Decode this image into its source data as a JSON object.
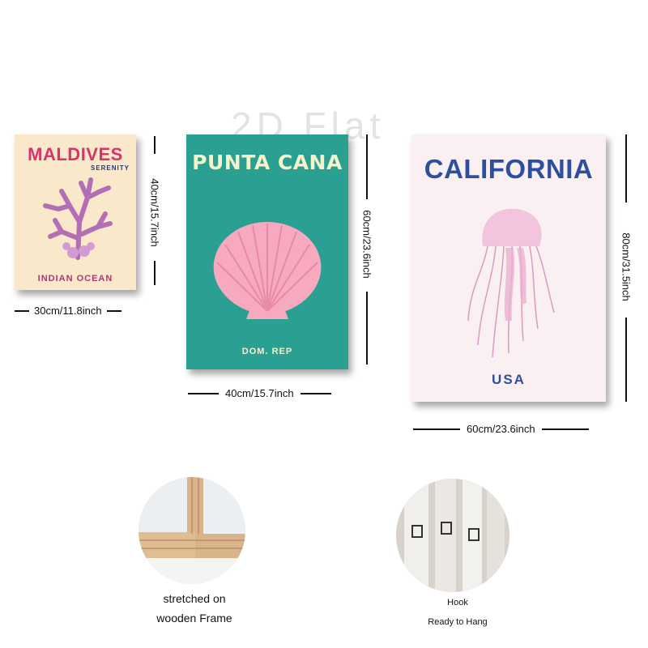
{
  "watermark": "2D Flat",
  "posters": {
    "maldives": {
      "title": "MALDIVES",
      "subtitle": "SERENITY",
      "footer": "INDIAN OCEAN",
      "width_label": "30cm/11.8inch",
      "height_label": "40cm/15.7inch"
    },
    "punta_cana": {
      "title": "PUNTA CANA",
      "footer": "DOM. REP",
      "width_label": "40cm/15.7inch",
      "height_label": "60cm/23.6inch"
    },
    "california": {
      "title": "CALIFORNIA",
      "footer": "USA",
      "width_label": "60cm/23.6inch",
      "height_label": "80cm/31.5inch"
    }
  },
  "features": {
    "frame": {
      "line1": "stretched on",
      "line2": "wooden Frame"
    },
    "hook": {
      "line1": "Hook",
      "line2": "Ready to Hang"
    }
  },
  "colors": {
    "maldives_bg": "#fae8cb",
    "maldives_title": "#d7346b",
    "coral": "#b36fb3",
    "punta_cana_bg": "#2aa093",
    "shell": "#f7a9c0",
    "california_bg": "#fbf0f1",
    "california_title": "#2d4fa0",
    "jellyfish": "#d99bc4"
  }
}
